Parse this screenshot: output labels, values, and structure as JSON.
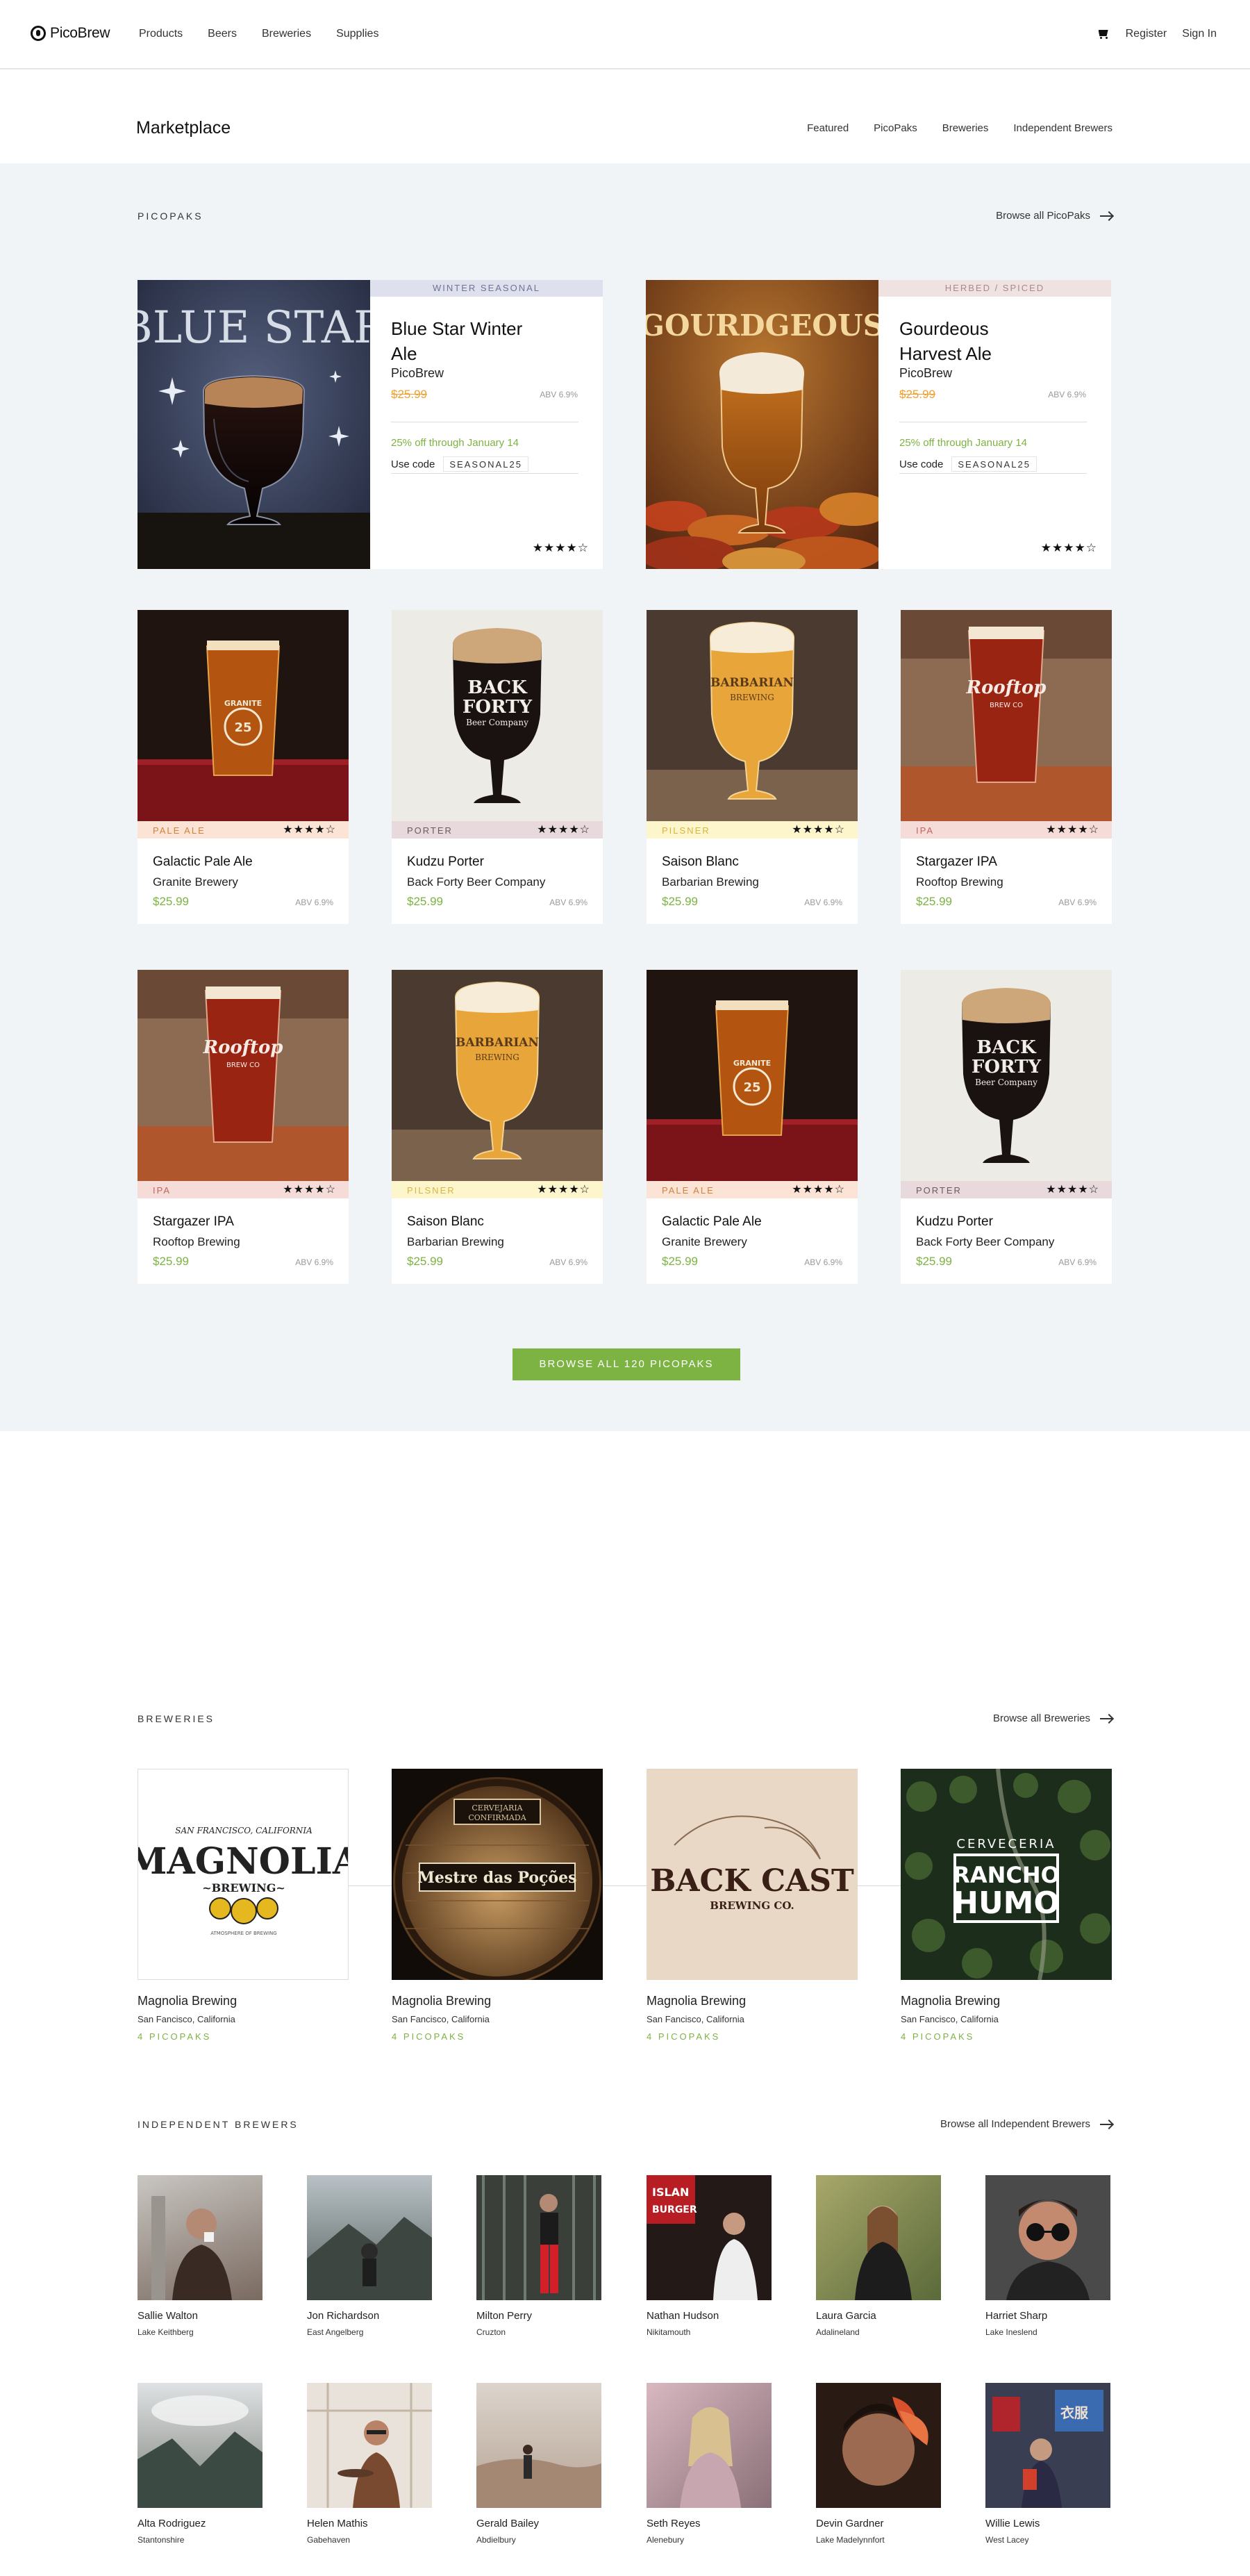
{
  "nav": {
    "logo": "PicoBrew",
    "links": [
      "Products",
      "Beers",
      "Breweries",
      "Supplies"
    ],
    "register": "Register",
    "signin": "Sign In"
  },
  "subheader": {
    "title": "Marketplace",
    "links": [
      "Featured",
      "PicoPaks",
      "Breweries",
      "Independent Brewers"
    ]
  },
  "picopaks": {
    "label": "PICOPAKS",
    "browse_link": "Browse all PicoPaks",
    "featured": [
      {
        "tag": "WINTER SEASONAL",
        "tag_bg": "#dfe0ee",
        "tag_color": "#6f7394",
        "image_label": "BLUE STAR",
        "name": "Blue Star Winter Ale",
        "brewery": "PicoBrew",
        "price": "$25.99",
        "abv": "ABV 6.9%",
        "promo": "25% off through January 14",
        "use_code": "Use code",
        "code": "SEASONAL25",
        "stars": "★★★★☆"
      },
      {
        "tag": "HERBED / SPICED",
        "tag_bg": "#efe3e1",
        "tag_color": "#a88",
        "image_label": "GOURDGEOUS",
        "name": "Gourdeous Harvest Ale",
        "brewery": "PicoBrew",
        "price": "$25.99",
        "abv": "ABV 6.9%",
        "promo": "25% off through January 14",
        "use_code": "Use code",
        "code": "SEASONAL25",
        "stars": "★★★★☆"
      }
    ],
    "cards": [
      {
        "tag": "PALE ALE",
        "band": "#fbe4d6",
        "tagcolor": "#d0813c",
        "name": "Galactic Pale Ale",
        "brewery": "Granite Brewery",
        "price": "$25.99",
        "abv": "ABV 6.9%",
        "stars": "★★★★☆",
        "glass_logo": "GRANITE"
      },
      {
        "tag": "PORTER",
        "band": "#e8d9dc",
        "tagcolor": "#6b5a5e",
        "name": "Kudzu Porter",
        "brewery": "Back Forty Beer Company",
        "price": "$25.99",
        "abv": "ABV 6.9%",
        "stars": "★★★★☆",
        "glass_logo": "BACK FORTY"
      },
      {
        "tag": "PILSNER",
        "band": "#fdf5cc",
        "tagcolor": "#d7b640",
        "name": "Saison Blanc",
        "brewery": "Barbarian Brewing",
        "price": "$25.99",
        "abv": "ABV 6.9%",
        "stars": "★★★★☆",
        "glass_logo": "BARBARIAN"
      },
      {
        "tag": "IPA",
        "band": "#f6dcd8",
        "tagcolor": "#c2645c",
        "name": "Stargazer IPA",
        "brewery": "Rooftop Brewing",
        "price": "$25.99",
        "abv": "ABV 6.9%",
        "stars": "★★★★☆",
        "glass_logo": "Rooftop"
      },
      {
        "tag": "IPA",
        "band": "#f6dcd8",
        "tagcolor": "#c2645c",
        "name": "Stargazer IPA",
        "brewery": "Rooftop Brewing",
        "price": "$25.99",
        "abv": "ABV 6.9%",
        "stars": "★★★★☆",
        "glass_logo": "Rooftop"
      },
      {
        "tag": "PILSNER",
        "band": "#fdf5cc",
        "tagcolor": "#d7b640",
        "name": "Saison Blanc",
        "brewery": "Barbarian Brewing",
        "price": "$25.99",
        "abv": "ABV 6.9%",
        "stars": "★★★★☆",
        "glass_logo": "BARBARIAN"
      },
      {
        "tag": "PALE ALE",
        "band": "#fbe4d6",
        "tagcolor": "#d0813c",
        "name": "Galactic Pale Ale",
        "brewery": "Granite Brewery",
        "price": "$25.99",
        "abv": "ABV 6.9%",
        "stars": "★★★★☆",
        "glass_logo": "GRANITE"
      },
      {
        "tag": "PORTER",
        "band": "#e8d9dc",
        "tagcolor": "#6b5a5e",
        "name": "Kudzu Porter",
        "brewery": "Back Forty Beer Company",
        "price": "$25.99",
        "abv": "ABV 6.9%",
        "stars": "★★★★☆",
        "glass_logo": "BACK FORTY"
      }
    ],
    "cta": "BROWSE ALL 120 PICOPAKS"
  },
  "breweries": {
    "label": "BREWERIES",
    "browse_link": "Browse all Breweries",
    "items": [
      {
        "logo_text": "MAGNOLIA",
        "name": "Magnolia Brewing",
        "location": "San Fancisco, California",
        "count": "4 PICOPAKS"
      },
      {
        "logo_text": "Mestre das Poções",
        "name": "Magnolia Brewing",
        "location": "San Fancisco, California",
        "count": "4 PICOPAKS"
      },
      {
        "logo_text": "BACK CAST",
        "name": "Magnolia Brewing",
        "location": "San Fancisco, California",
        "count": "4 PICOPAKS"
      },
      {
        "logo_text": "RANCHO HUMO",
        "name": "Magnolia Brewing",
        "location": "San Fancisco, California",
        "count": "4 PICOPAKS"
      }
    ]
  },
  "brewers": {
    "label": "INDEPENDENT BREWERS",
    "browse_link": "Browse all Independent Brewers",
    "people": [
      {
        "name": "Sallie Walton",
        "location": "Lake Keithberg"
      },
      {
        "name": "Jon Richardson",
        "location": "East Angelberg"
      },
      {
        "name": "Milton Perry",
        "location": "Cruzton"
      },
      {
        "name": "Nathan Hudson",
        "location": "Nikitamouth"
      },
      {
        "name": "Laura Garcia",
        "location": "Adalineland"
      },
      {
        "name": "Harriet Sharp",
        "location": "Lake Ineslend"
      },
      {
        "name": "Alta Rodriguez",
        "location": "Stantonshire"
      },
      {
        "name": "Helen Mathis",
        "location": "Gabehaven"
      },
      {
        "name": "Gerald Bailey",
        "location": "Abdielbury"
      },
      {
        "name": "Seth Reyes",
        "location": "Alenebury"
      },
      {
        "name": "Devin Gardner",
        "location": "Lake Madelynnfort"
      },
      {
        "name": "Willie Lewis",
        "location": "West Lacey"
      }
    ]
  }
}
